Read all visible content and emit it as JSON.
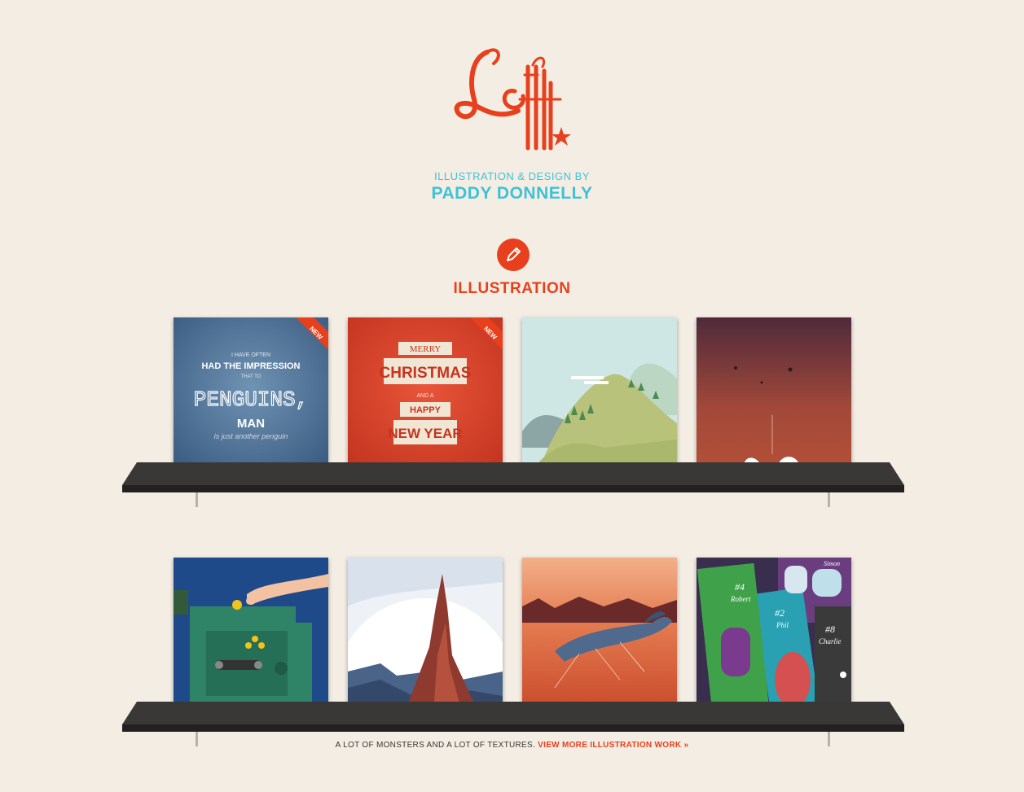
{
  "brand": {
    "logo_text": "Lefft",
    "tagline_small": "ILLUSTRATION & DESIGN BY",
    "tagline_name": "PADDY DONNELLY",
    "accent_color": "#e8401c",
    "secondary_color": "#3fc2d6"
  },
  "section": {
    "icon": "pencil-icon",
    "title": "ILLUSTRATION"
  },
  "tiles": [
    {
      "name": "penguins-typography",
      "badge": "NEW",
      "lines": [
        "I HAVE OFTEN",
        "HAD THE IMPRESSION",
        "THAT TO",
        "PENGUINS,",
        "MAN",
        "is just another penguin"
      ]
    },
    {
      "name": "merry-christmas",
      "badge": "NEW",
      "lines": [
        "MERRY",
        "CHRISTMAS",
        "AND A",
        "HAPPY",
        "NEW YEAR"
      ]
    },
    {
      "name": "green-hills"
    },
    {
      "name": "red-landscape"
    },
    {
      "name": "hand-machine"
    },
    {
      "name": "moon-desert"
    },
    {
      "name": "whale-desert"
    },
    {
      "name": "monster-cards",
      "labels": [
        "#4",
        "Robert",
        "#2",
        "Phil",
        "#8",
        "Charlie",
        "Simon"
      ]
    }
  ],
  "footer": {
    "text": "A LOT OF MONSTERS AND A LOT OF TEXTURES.",
    "link": "VIEW MORE ILLUSTRATION WORK »"
  }
}
